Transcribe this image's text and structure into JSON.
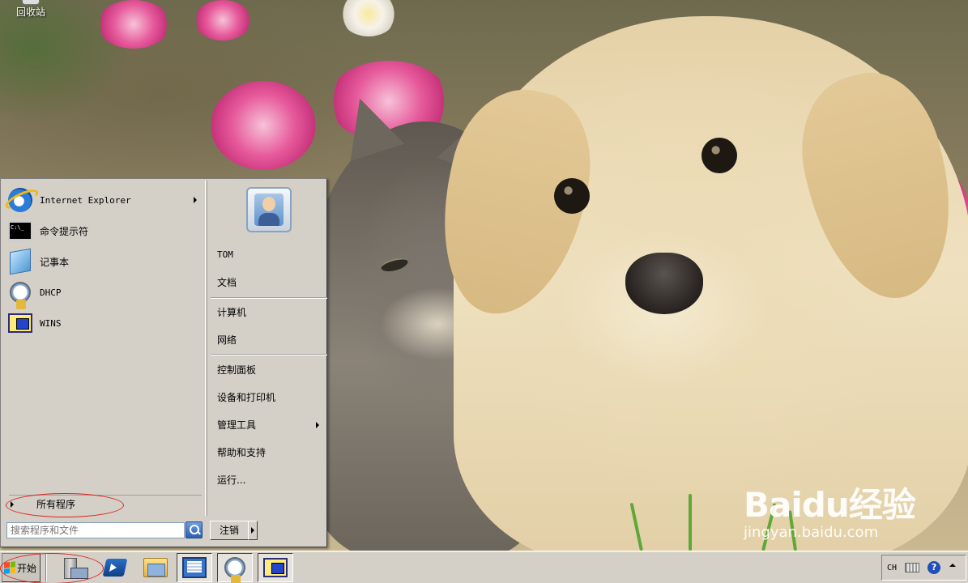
{
  "desktop": {
    "recycle_bin_label": "回收站",
    "watermark_text": "Baidu经验",
    "watermark_url": "jingyan.baidu.com"
  },
  "start_menu": {
    "programs": [
      {
        "label": "Internet Explorer",
        "icon": "internet-explorer-icon",
        "has_submenu": true
      },
      {
        "label": "命令提示符",
        "icon": "command-prompt-icon",
        "has_submenu": false
      },
      {
        "label": "记事本",
        "icon": "notepad-icon",
        "has_submenu": false
      },
      {
        "label": "DHCP",
        "icon": "dhcp-icon",
        "has_submenu": false
      },
      {
        "label": "WINS",
        "icon": "wins-icon",
        "has_submenu": false
      }
    ],
    "all_programs_label": "所有程序",
    "user_name": "TOM",
    "right_items": [
      {
        "label": "文档"
      },
      {
        "label": "计算机"
      },
      {
        "label": "网络"
      },
      {
        "label": "控制面板"
      },
      {
        "label": "设备和打印机"
      },
      {
        "label": "管理工具",
        "has_submenu": true
      },
      {
        "label": "帮助和支持"
      },
      {
        "label": "运行..."
      }
    ],
    "search_placeholder": "搜索程序和文件",
    "logoff_label": "注销"
  },
  "taskbar": {
    "start_label": "开始",
    "pinned": [
      "server-manager-icon",
      "powershell-icon",
      "explorer-folder-icon",
      "computer-management-icon",
      "dhcp-icon",
      "wins-icon"
    ],
    "tray": {
      "language": "CH"
    }
  },
  "colors": {
    "menu_bg": "#d4d0c8",
    "highlight_circle": "#d82323",
    "search_button": "#2d5fb1"
  }
}
